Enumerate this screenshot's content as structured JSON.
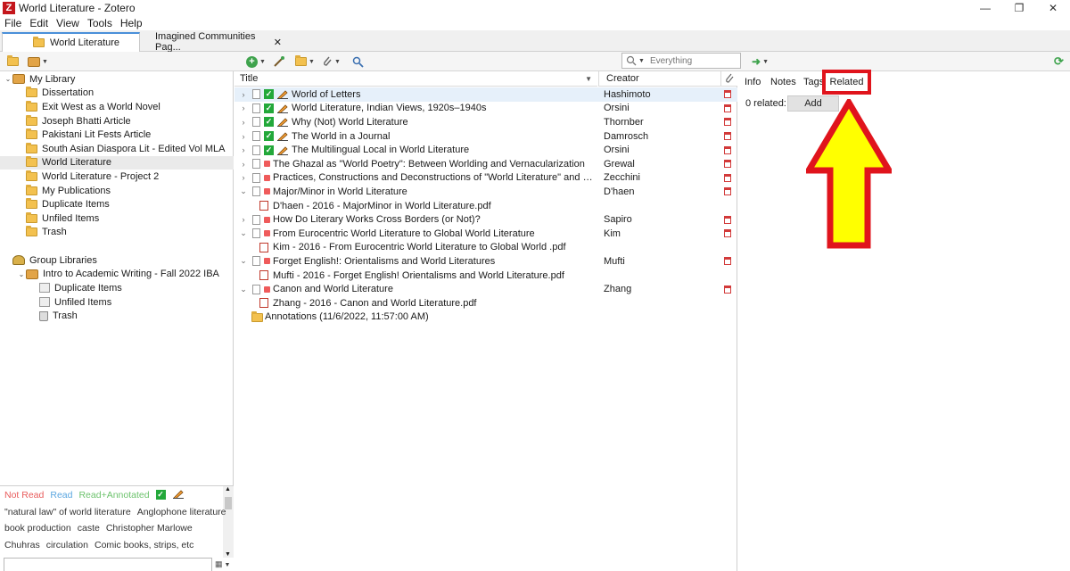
{
  "window": {
    "title": "World Literature - Zotero",
    "app_icon_letter": "Z",
    "controls": {
      "minimize": "—",
      "maximize": "❐",
      "close": "✕"
    }
  },
  "menubar": {
    "items": [
      {
        "label": "File"
      },
      {
        "label": "Edit"
      },
      {
        "label": "View"
      },
      {
        "label": "Tools"
      },
      {
        "label": "Help"
      }
    ]
  },
  "tabs": [
    {
      "label": "World Literature",
      "active": true
    },
    {
      "label": "Imagined Communities Pag...",
      "active": false,
      "close": "✕"
    }
  ],
  "toolbar": {
    "search_placeholder": "Everything",
    "search_icon": "search-icon",
    "locate_icon": "magnifier-icon",
    "sync_icon": "sync-icon"
  },
  "library_tree": [
    {
      "label": "My Library",
      "icon": "library-icon",
      "twisty": "⌄",
      "level": 0
    },
    {
      "label": "Dissertation",
      "icon": "folder-icon",
      "level": 1
    },
    {
      "label": "Exit West as a World Novel",
      "icon": "folder-icon",
      "level": 1
    },
    {
      "label": "Joseph Bhatti Article",
      "icon": "folder-icon",
      "level": 1
    },
    {
      "label": "Pakistani Lit Fests Article",
      "icon": "folder-icon",
      "level": 1
    },
    {
      "label": "South Asian Diaspora Lit - Edited Vol MLA",
      "icon": "folder-icon",
      "level": 1
    },
    {
      "label": "World Literature",
      "icon": "folder-icon",
      "level": 1,
      "selected": true
    },
    {
      "label": "World Literature - Project 2",
      "icon": "folder-icon",
      "level": 1
    },
    {
      "label": "My Publications",
      "icon": "folder-icon",
      "level": 1
    },
    {
      "label": "Duplicate Items",
      "icon": "folder-icon",
      "level": 1
    },
    {
      "label": "Unfiled Items",
      "icon": "folder-icon",
      "level": 1
    },
    {
      "label": "Trash",
      "icon": "folder-icon",
      "level": 1
    }
  ],
  "group_tree": [
    {
      "label": "Group Libraries",
      "icon": "group-icon",
      "level": 0
    },
    {
      "label": "Intro to Academic Writing - Fall 2022 IBA",
      "icon": "library-icon",
      "twisty": "⌄",
      "level": 1
    },
    {
      "label": "Duplicate Items",
      "icon": "duplicate-icon",
      "level": 2
    },
    {
      "label": "Unfiled Items",
      "icon": "unfiled-icon",
      "level": 2
    },
    {
      "label": "Trash",
      "icon": "trash-icon",
      "level": 2
    }
  ],
  "tags": {
    "colored": [
      {
        "label": "Not Read",
        "color": "#e85b5b"
      },
      {
        "label": "Read",
        "color": "#5aa6e0"
      },
      {
        "label": "Read+Annotated",
        "color": "#6cc26c"
      }
    ],
    "rows": [
      [
        "\"natural law\" of world literature",
        "Anglophone literature"
      ],
      [
        "book production",
        "caste",
        "Christopher Marlowe"
      ],
      [
        "Chuhras",
        "circulation",
        "Comic books, strips, etc"
      ]
    ],
    "filter_placeholder": ""
  },
  "items_table": {
    "columns": {
      "title": "Title",
      "creator": "Creator"
    },
    "rows": [
      {
        "title": "World of Letters",
        "creator": "Hashimoto",
        "kind": "item",
        "twisty": "›",
        "read": true,
        "annotated": true,
        "attachment": true,
        "selected": true
      },
      {
        "title": "World Literature, Indian Views, 1920s–1940s",
        "creator": "Orsini",
        "kind": "item",
        "twisty": "›",
        "read": true,
        "annotated": true,
        "attachment": true
      },
      {
        "title": "Why (Not) World Literature",
        "creator": "Thornber",
        "kind": "item",
        "twisty": "›",
        "read": true,
        "annotated": true,
        "attachment": true
      },
      {
        "title": "The World in a Journal",
        "creator": "Damrosch",
        "kind": "item",
        "twisty": "›",
        "read": true,
        "annotated": true,
        "attachment": true
      },
      {
        "title": "The Multilingual Local in World Literature",
        "creator": "Orsini",
        "kind": "item",
        "twisty": "›",
        "read": true,
        "annotated": true,
        "attachment": true
      },
      {
        "title": "The Ghazal as \"World Poetry\": Between Worlding and Vernacularization",
        "creator": "Grewal",
        "kind": "item",
        "twisty": "›",
        "unread": true,
        "attachment": true
      },
      {
        "title": "Practices, Constructions and Deconstructions of \"World Literature\" and \"Indian Literatu...",
        "creator": "Zecchini",
        "kind": "item",
        "twisty": "›",
        "unread": true,
        "attachment": true
      },
      {
        "title": "Major/Minor in World Literature",
        "creator": "D'haen",
        "kind": "item",
        "twisty": "⌄",
        "unread": true,
        "attachment": true
      },
      {
        "title": "D'haen - 2016 - MajorMinor in World Literature.pdf",
        "creator": "",
        "kind": "pdf"
      },
      {
        "title": "How Do Literary Works Cross Borders (or Not)?",
        "creator": "Sapiro",
        "kind": "item",
        "twisty": "›",
        "unread": true,
        "attachment": true
      },
      {
        "title": "From Eurocentric World Literature to Global World Literature",
        "creator": "Kim",
        "kind": "item",
        "twisty": "⌄",
        "unread": true,
        "attachment": true
      },
      {
        "title": "Kim - 2016 - From Eurocentric World Literature to Global World .pdf",
        "creator": "",
        "kind": "pdf"
      },
      {
        "title": "Forget English!: Orientalisms and World Literatures",
        "creator": "Mufti",
        "kind": "item",
        "twisty": "⌄",
        "unread": true,
        "attachment": true
      },
      {
        "title": "Mufti - 2016 - Forget English! Orientalisms and World Literature.pdf",
        "creator": "",
        "kind": "pdf"
      },
      {
        "title": "Canon and World Literature",
        "creator": "Zhang",
        "kind": "item",
        "twisty": "⌄",
        "unread": true,
        "attachment": true
      },
      {
        "title": "Zhang - 2016 - Canon and World Literature.pdf",
        "creator": "",
        "kind": "pdf"
      },
      {
        "title": "Annotations (11/6/2022, 11:57:00 AM)",
        "creator": "",
        "kind": "annotations"
      }
    ]
  },
  "item_pane": {
    "tabs": [
      {
        "label": "Info"
      },
      {
        "label": "Notes"
      },
      {
        "label": "Tags"
      },
      {
        "label": "Related",
        "highlighted": true
      }
    ],
    "related_count_label": "0 related:",
    "add_label": "Add",
    "highlight_color": "#e0141c",
    "arrow_fill": "#ffff00"
  }
}
